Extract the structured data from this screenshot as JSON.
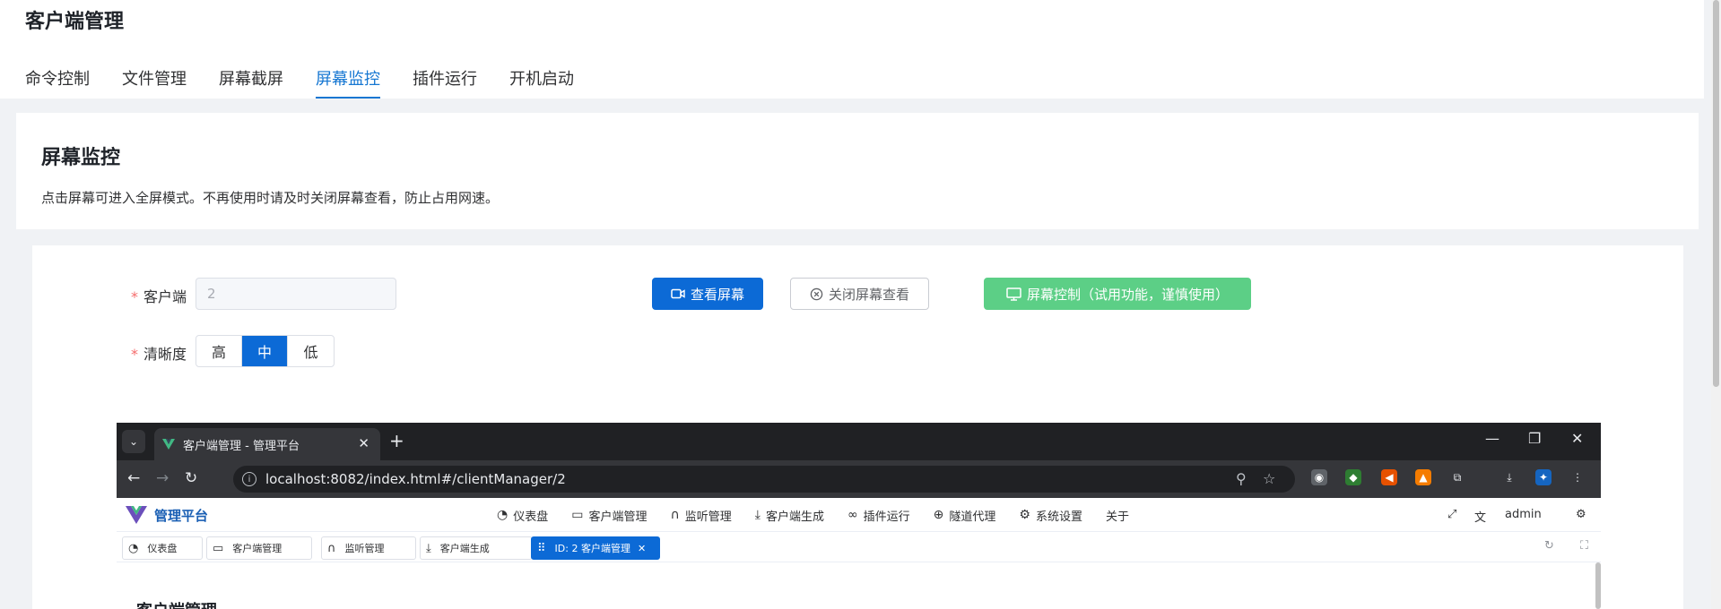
{
  "header": {
    "title": "客户端管理",
    "tabs": [
      {
        "label": "命令控制"
      },
      {
        "label": "文件管理"
      },
      {
        "label": "屏幕截屏"
      },
      {
        "label": "屏幕监控"
      },
      {
        "label": "插件运行"
      },
      {
        "label": "开机启动"
      }
    ],
    "active_tab": "屏幕监控"
  },
  "info": {
    "title": "屏幕监控",
    "description": "点击屏幕可进入全屏模式。不再使用时请及时关闭屏幕查看，防止占用网速。"
  },
  "form": {
    "required_mark": "*",
    "client_label": "客户端",
    "client_value": "2",
    "clarity_label": "清晰度",
    "clarity_options": [
      "高",
      "中",
      "低"
    ],
    "clarity_selected": "中",
    "view_button": "查看屏幕",
    "close_button": "关闭屏幕查看",
    "control_button": "屏幕控制（试用功能，谨慎使用）",
    "colors": {
      "primary": "#0c6ad6",
      "success": "#5ccf86",
      "required": "#f56c6c"
    }
  },
  "screen": {
    "browser_tab_title": "客户端管理 - 管理平台",
    "url": "localhost:8082/index.html#/clientManager/2",
    "app_title": "管理平台",
    "menu": [
      {
        "label": "仪表盘",
        "icon": "dashboard-icon"
      },
      {
        "label": "客户端管理",
        "icon": "monitor-icon"
      },
      {
        "label": "监听管理",
        "icon": "headset-icon"
      },
      {
        "label": "客户端生成",
        "icon": "download-icon"
      },
      {
        "label": "插件运行",
        "icon": "link-icon"
      },
      {
        "label": "隧道代理",
        "icon": "globe-icon"
      },
      {
        "label": "系统设置",
        "icon": "gear-icon"
      },
      {
        "label": "关于",
        "icon": ""
      }
    ],
    "user": "admin",
    "tags": [
      {
        "label": "仪表盘",
        "icon": "dashboard-icon"
      },
      {
        "label": "客户端管理",
        "icon": "monitor-icon"
      },
      {
        "label": "监听管理",
        "icon": "headset-icon"
      },
      {
        "label": "客户端生成",
        "icon": "download-icon"
      },
      {
        "label": "ID: 2 客户端管理",
        "icon": "drag-icon"
      }
    ],
    "content_title": "客户端管理"
  }
}
